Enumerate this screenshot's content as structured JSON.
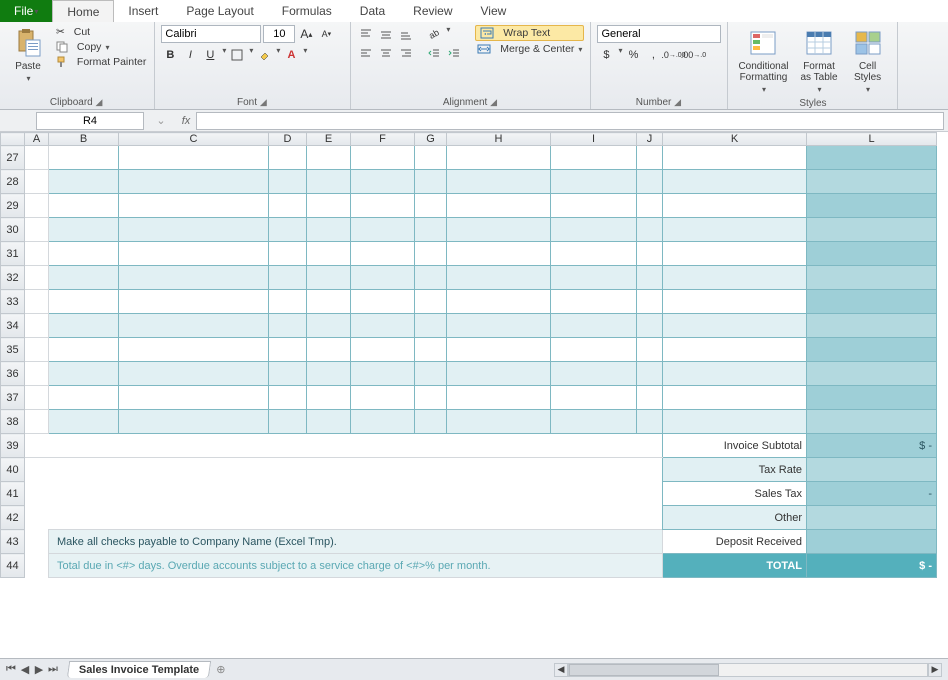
{
  "tabs": {
    "file": "File",
    "items": [
      "Home",
      "Insert",
      "Page Layout",
      "Formulas",
      "Data",
      "Review",
      "View"
    ],
    "active": "Home"
  },
  "ribbon": {
    "clipboard": {
      "label": "Clipboard",
      "paste": "Paste",
      "cut": "Cut",
      "copy": "Copy",
      "format_painter": "Format Painter"
    },
    "font": {
      "label": "Font",
      "name": "Calibri",
      "size": "10",
      "bold": "B",
      "italic": "I",
      "underline": "U"
    },
    "alignment": {
      "label": "Alignment",
      "wrap": "Wrap Text",
      "merge": "Merge & Center"
    },
    "number": {
      "label": "Number",
      "format": "General",
      "currency": "$",
      "percent": "%",
      "comma": ","
    },
    "styles": {
      "label": "Styles",
      "cond": "Conditional\nFormatting",
      "table": "Format\nas Table",
      "cell": "Cell\nStyles"
    }
  },
  "fx": {
    "name": "R4",
    "formula": ""
  },
  "columns": [
    "A",
    "B",
    "C",
    "D",
    "E",
    "F",
    "G",
    "H",
    "I",
    "J",
    "K",
    "L"
  ],
  "rows": {
    "start": 27,
    "end": 44
  },
  "summary": {
    "subtotal_label": "Invoice Subtotal",
    "subtotal_value": "$                  -",
    "tax_rate_label": "Tax Rate",
    "tax_rate_value": "",
    "sales_tax_label": "Sales Tax",
    "sales_tax_value": "-",
    "other_label": "Other",
    "other_value": "",
    "deposit_label": "Deposit Received",
    "deposit_value": "",
    "total_label": "TOTAL",
    "total_value": "$                  -"
  },
  "notes": {
    "line1": "Make all checks payable to Company Name (Excel Tmp).",
    "line2": "Total due in <#> days. Overdue accounts subject to a service charge of <#>% per month."
  },
  "sheet": {
    "name": "Sales Invoice Template"
  }
}
